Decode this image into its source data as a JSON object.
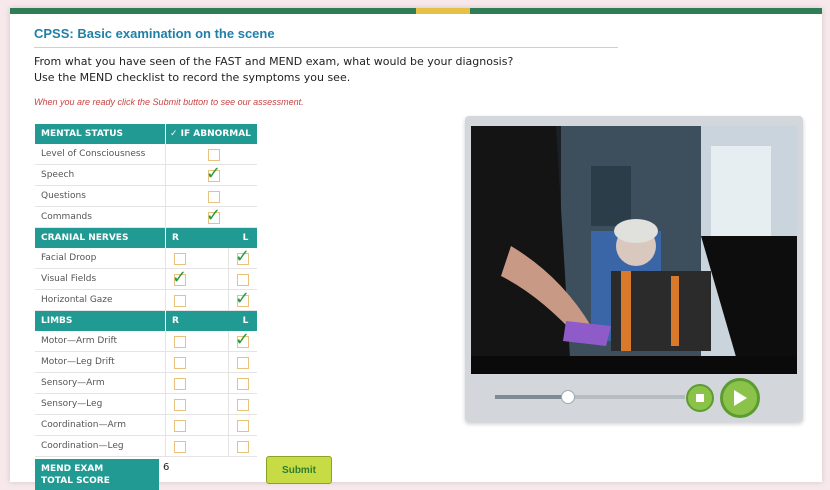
{
  "title": "CPSS: Basic examination on the scene",
  "instructions": {
    "line1": "From what you have seen of the FAST and MEND exam, what would be your diagnosis?",
    "line2": "Use the MEND checklist to record the symptoms you see.",
    "note": "When you are ready click the Submit button to see our assessment."
  },
  "mental_status": {
    "header": "MENTAL STATUS",
    "col_header": "✓ IF ABNORMAL",
    "rows": [
      {
        "label": "Level of Consciousness",
        "checked": false
      },
      {
        "label": "Speech",
        "checked": true
      },
      {
        "label": "Questions",
        "checked": false
      },
      {
        "label": "Commands",
        "checked": true
      }
    ]
  },
  "cranial_nerves": {
    "header": "CRANIAL NERVES",
    "col_r": "R",
    "col_l": "L",
    "rows": [
      {
        "label": "Facial Droop",
        "r": false,
        "l": true
      },
      {
        "label": "Visual Fields",
        "r": true,
        "l": false
      },
      {
        "label": "Horizontal Gaze",
        "r": false,
        "l": true
      }
    ]
  },
  "limbs": {
    "header": "LIMBS",
    "col_r": "R",
    "col_l": "L",
    "rows": [
      {
        "label": "Motor—Arm Drift",
        "r": false,
        "l": true
      },
      {
        "label": "Motor—Leg Drift",
        "r": false,
        "l": false
      },
      {
        "label": "Sensory—Arm",
        "r": false,
        "l": false
      },
      {
        "label": "Sensory—Leg",
        "r": false,
        "l": false
      },
      {
        "label": "Coordination—Arm",
        "r": false,
        "l": false
      },
      {
        "label": "Coordination—Leg",
        "r": false,
        "l": false
      }
    ]
  },
  "score": {
    "label_line1": "MEND EXAM",
    "label_line2": "TOTAL SCORE",
    "value": "6"
  },
  "submit_label": "Submit",
  "player": {
    "progress": 0.38,
    "stop_icon": "stop-icon",
    "play_icon": "play-icon"
  },
  "colors": {
    "teal": "#219a93",
    "title_blue": "#1f7fa9",
    "note_red": "#c84343",
    "check_green": "#2a9a3a",
    "button_green": "#c7db45"
  }
}
